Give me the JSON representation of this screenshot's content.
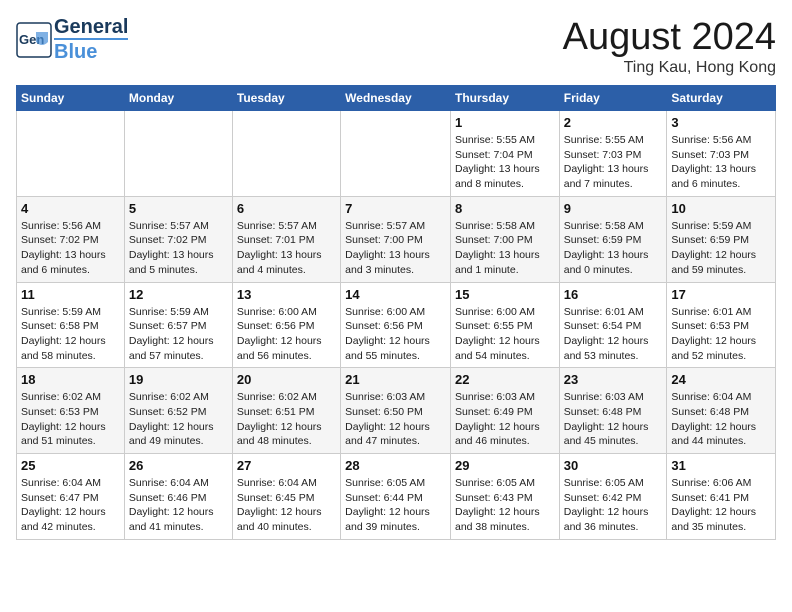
{
  "header": {
    "logo_general": "General",
    "logo_blue": "Blue",
    "month": "August 2024",
    "location": "Ting Kau, Hong Kong"
  },
  "days_of_week": [
    "Sunday",
    "Monday",
    "Tuesday",
    "Wednesday",
    "Thursday",
    "Friday",
    "Saturday"
  ],
  "weeks": [
    [
      {
        "day": "",
        "content": ""
      },
      {
        "day": "",
        "content": ""
      },
      {
        "day": "",
        "content": ""
      },
      {
        "day": "",
        "content": ""
      },
      {
        "day": "1",
        "content": "Sunrise: 5:55 AM\nSunset: 7:04 PM\nDaylight: 13 hours\nand 8 minutes."
      },
      {
        "day": "2",
        "content": "Sunrise: 5:55 AM\nSunset: 7:03 PM\nDaylight: 13 hours\nand 7 minutes."
      },
      {
        "day": "3",
        "content": "Sunrise: 5:56 AM\nSunset: 7:03 PM\nDaylight: 13 hours\nand 6 minutes."
      }
    ],
    [
      {
        "day": "4",
        "content": "Sunrise: 5:56 AM\nSunset: 7:02 PM\nDaylight: 13 hours\nand 6 minutes."
      },
      {
        "day": "5",
        "content": "Sunrise: 5:57 AM\nSunset: 7:02 PM\nDaylight: 13 hours\nand 5 minutes."
      },
      {
        "day": "6",
        "content": "Sunrise: 5:57 AM\nSunset: 7:01 PM\nDaylight: 13 hours\nand 4 minutes."
      },
      {
        "day": "7",
        "content": "Sunrise: 5:57 AM\nSunset: 7:00 PM\nDaylight: 13 hours\nand 3 minutes."
      },
      {
        "day": "8",
        "content": "Sunrise: 5:58 AM\nSunset: 7:00 PM\nDaylight: 13 hours\nand 1 minute."
      },
      {
        "day": "9",
        "content": "Sunrise: 5:58 AM\nSunset: 6:59 PM\nDaylight: 13 hours\nand 0 minutes."
      },
      {
        "day": "10",
        "content": "Sunrise: 5:59 AM\nSunset: 6:59 PM\nDaylight: 12 hours\nand 59 minutes."
      }
    ],
    [
      {
        "day": "11",
        "content": "Sunrise: 5:59 AM\nSunset: 6:58 PM\nDaylight: 12 hours\nand 58 minutes."
      },
      {
        "day": "12",
        "content": "Sunrise: 5:59 AM\nSunset: 6:57 PM\nDaylight: 12 hours\nand 57 minutes."
      },
      {
        "day": "13",
        "content": "Sunrise: 6:00 AM\nSunset: 6:56 PM\nDaylight: 12 hours\nand 56 minutes."
      },
      {
        "day": "14",
        "content": "Sunrise: 6:00 AM\nSunset: 6:56 PM\nDaylight: 12 hours\nand 55 minutes."
      },
      {
        "day": "15",
        "content": "Sunrise: 6:00 AM\nSunset: 6:55 PM\nDaylight: 12 hours\nand 54 minutes."
      },
      {
        "day": "16",
        "content": "Sunrise: 6:01 AM\nSunset: 6:54 PM\nDaylight: 12 hours\nand 53 minutes."
      },
      {
        "day": "17",
        "content": "Sunrise: 6:01 AM\nSunset: 6:53 PM\nDaylight: 12 hours\nand 52 minutes."
      }
    ],
    [
      {
        "day": "18",
        "content": "Sunrise: 6:02 AM\nSunset: 6:53 PM\nDaylight: 12 hours\nand 51 minutes."
      },
      {
        "day": "19",
        "content": "Sunrise: 6:02 AM\nSunset: 6:52 PM\nDaylight: 12 hours\nand 49 minutes."
      },
      {
        "day": "20",
        "content": "Sunrise: 6:02 AM\nSunset: 6:51 PM\nDaylight: 12 hours\nand 48 minutes."
      },
      {
        "day": "21",
        "content": "Sunrise: 6:03 AM\nSunset: 6:50 PM\nDaylight: 12 hours\nand 47 minutes."
      },
      {
        "day": "22",
        "content": "Sunrise: 6:03 AM\nSunset: 6:49 PM\nDaylight: 12 hours\nand 46 minutes."
      },
      {
        "day": "23",
        "content": "Sunrise: 6:03 AM\nSunset: 6:48 PM\nDaylight: 12 hours\nand 45 minutes."
      },
      {
        "day": "24",
        "content": "Sunrise: 6:04 AM\nSunset: 6:48 PM\nDaylight: 12 hours\nand 44 minutes."
      }
    ],
    [
      {
        "day": "25",
        "content": "Sunrise: 6:04 AM\nSunset: 6:47 PM\nDaylight: 12 hours\nand 42 minutes."
      },
      {
        "day": "26",
        "content": "Sunrise: 6:04 AM\nSunset: 6:46 PM\nDaylight: 12 hours\nand 41 minutes."
      },
      {
        "day": "27",
        "content": "Sunrise: 6:04 AM\nSunset: 6:45 PM\nDaylight: 12 hours\nand 40 minutes."
      },
      {
        "day": "28",
        "content": "Sunrise: 6:05 AM\nSunset: 6:44 PM\nDaylight: 12 hours\nand 39 minutes."
      },
      {
        "day": "29",
        "content": "Sunrise: 6:05 AM\nSunset: 6:43 PM\nDaylight: 12 hours\nand 38 minutes."
      },
      {
        "day": "30",
        "content": "Sunrise: 6:05 AM\nSunset: 6:42 PM\nDaylight: 12 hours\nand 36 minutes."
      },
      {
        "day": "31",
        "content": "Sunrise: 6:06 AM\nSunset: 6:41 PM\nDaylight: 12 hours\nand 35 minutes."
      }
    ]
  ]
}
